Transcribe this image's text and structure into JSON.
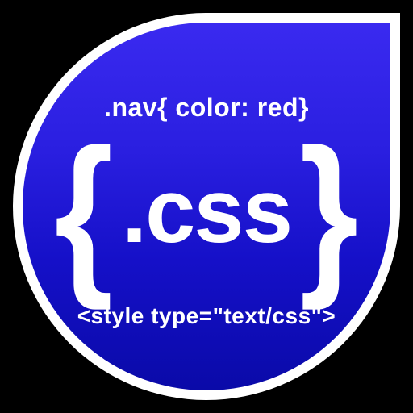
{
  "badge": {
    "top_text": ".nav{ color: red}",
    "brace_left": "{",
    "center_label": ".css",
    "brace_right": "}",
    "bottom_text": "<style type=\"text/css\">"
  }
}
